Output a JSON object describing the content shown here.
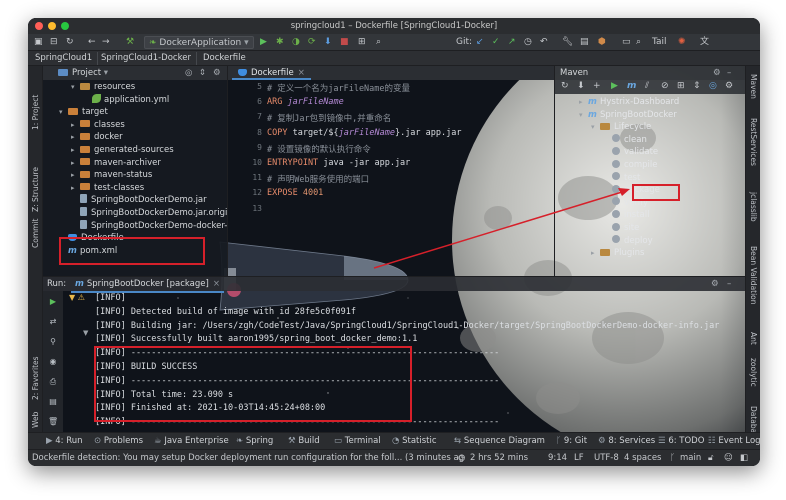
{
  "window": {
    "title": "springcloud1 – Dockerfile [SpringCloud1-Docker]"
  },
  "toolbar": {
    "run_config": "DockerApplication",
    "git_label": "Git:",
    "tail_label": "Tail"
  },
  "breadcrumbs": [
    "SpringCloud1",
    "SpringCloud1-Docker",
    "Dockerfile"
  ],
  "left_stripe": [
    "1: Project",
    "Z: Structure",
    "Commit",
    "2: Favorites",
    "Web"
  ],
  "right_stripe": [
    "Maven",
    "RestServices",
    "jclasslib",
    "Bean Validation",
    "Ant",
    "zoolytic",
    "Database"
  ],
  "project": {
    "header": "Project",
    "tree": [
      {
        "label": "resources",
        "depth": 2,
        "icon": "folder",
        "arrow": "▾"
      },
      {
        "label": "application.yml",
        "depth": 3,
        "icon": "leaf",
        "arrow": ""
      },
      {
        "label": "target",
        "depth": 1,
        "icon": "folder-orange",
        "arrow": "▾"
      },
      {
        "label": "classes",
        "depth": 2,
        "icon": "folder-orange",
        "arrow": "▸"
      },
      {
        "label": "docker",
        "depth": 2,
        "icon": "folder-orange",
        "arrow": "▸"
      },
      {
        "label": "generated-sources",
        "depth": 2,
        "icon": "folder-orange",
        "arrow": "▸"
      },
      {
        "label": "maven-archiver",
        "depth": 2,
        "icon": "folder-orange",
        "arrow": "▸"
      },
      {
        "label": "maven-status",
        "depth": 2,
        "icon": "folder-orange",
        "arrow": "▸"
      },
      {
        "label": "test-classes",
        "depth": 2,
        "icon": "folder-orange",
        "arrow": "▸"
      },
      {
        "label": "SpringBootDockerDemo.jar",
        "depth": 2,
        "icon": "file",
        "arrow": ""
      },
      {
        "label": "SpringBootDockerDemo.jar.original",
        "depth": 2,
        "icon": "file",
        "arrow": ""
      },
      {
        "label": "SpringBootDockerDemo-docker-info.jar",
        "depth": 2,
        "icon": "file",
        "arrow": ""
      },
      {
        "label": "Dockerfile",
        "depth": 1,
        "icon": "whale",
        "arrow": ""
      },
      {
        "label": "pom.xml",
        "depth": 1,
        "icon": "maven",
        "arrow": ""
      }
    ]
  },
  "editor": {
    "tab": "Dockerfile",
    "lines": [
      {
        "n": "5",
        "parts": [
          {
            "c": "cmt",
            "t": "# 定义一个名为jarFileName的变量"
          }
        ]
      },
      {
        "n": "6",
        "parts": [
          {
            "c": "kw",
            "t": "ARG "
          },
          {
            "c": "var",
            "t": "jarFileName"
          }
        ]
      },
      {
        "n": "7",
        "parts": [
          {
            "c": "cmt",
            "t": "# 复制Jar包到镜像中,并重命名"
          }
        ]
      },
      {
        "n": "8",
        "parts": [
          {
            "c": "kw",
            "t": "COPY "
          },
          {
            "c": "plain",
            "t": "target/${"
          },
          {
            "c": "var",
            "t": "jarFileName"
          },
          {
            "c": "plain",
            "t": "}.jar app.jar"
          }
        ]
      },
      {
        "n": "9",
        "parts": [
          {
            "c": "cmt",
            "t": "# 设置镜像的默认执行命令"
          }
        ]
      },
      {
        "n": "10",
        "parts": [
          {
            "c": "kw",
            "t": "ENTRYPOINT "
          },
          {
            "c": "plain",
            "t": "java -jar app.jar"
          }
        ]
      },
      {
        "n": "11",
        "parts": [
          {
            "c": "cmt",
            "t": "# 声明Web服务使用的端口"
          }
        ]
      },
      {
        "n": "12",
        "parts": [
          {
            "c": "kw",
            "t": "EXPOSE "
          },
          {
            "c": "num",
            "t": "4001"
          }
        ]
      },
      {
        "n": "13",
        "parts": []
      }
    ]
  },
  "maven": {
    "header": "Maven",
    "tree": [
      {
        "label": "Hystrix-Dashboard",
        "depth": 0,
        "icon": "maven",
        "arrow": "▸"
      },
      {
        "label": "SpringBootDocker",
        "depth": 0,
        "icon": "maven",
        "arrow": "▾"
      },
      {
        "label": "Lifecycle",
        "depth": 1,
        "icon": "folder",
        "arrow": "▾"
      },
      {
        "label": "clean",
        "depth": 2,
        "icon": "gear",
        "arrow": ""
      },
      {
        "label": "validate",
        "depth": 2,
        "icon": "gear",
        "arrow": ""
      },
      {
        "label": "compile",
        "depth": 2,
        "icon": "gear",
        "arrow": ""
      },
      {
        "label": "test",
        "depth": 2,
        "icon": "gear",
        "arrow": ""
      },
      {
        "label": "package",
        "depth": 2,
        "icon": "gear",
        "arrow": ""
      },
      {
        "label": "verify",
        "depth": 2,
        "icon": "gear",
        "arrow": ""
      },
      {
        "label": "install",
        "depth": 2,
        "icon": "gear",
        "arrow": ""
      },
      {
        "label": "site",
        "depth": 2,
        "icon": "gear",
        "arrow": ""
      },
      {
        "label": "deploy",
        "depth": 2,
        "icon": "gear",
        "arrow": ""
      },
      {
        "label": "Plugins",
        "depth": 1,
        "icon": "folder",
        "arrow": "▸"
      }
    ]
  },
  "run": {
    "label": "Run:",
    "tab": "SpringBootDocker [package]",
    "lines": [
      "[INFO]",
      "[INFO] Detected build of image with id 28fe5c0f091f",
      "[INFO] Building jar: /Users/zgh/CodeTest/Java/SpringCloud1/SpringCloud1-Docker/target/SpringBootDockerDemo-docker-info.jar",
      "[INFO] Successfully built aaron1995/spring_boot_docker_demo:1.1",
      "[INFO] ------------------------------------------------------------------------",
      "[INFO] BUILD SUCCESS",
      "[INFO] ------------------------------------------------------------------------",
      "[INFO] Total time:  23.090 s",
      "[INFO] Finished at: 2021-10-03T14:45:24+08:00",
      "[INFO] ------------------------------------------------------------------------"
    ]
  },
  "bottom_tools": [
    "4: Run",
    "Problems",
    "Java Enterprise",
    "Spring",
    "Build",
    "Terminal",
    "Statistic",
    "Sequence Diagram",
    "9: Git",
    "8: Services",
    "6: TODO",
    "Event Log"
  ],
  "status": {
    "message": "Dockerfile detection: You may setup Docker deployment run configuration for the foll... (3 minutes ag",
    "time": "2 hrs 52 mins",
    "position": "9:14",
    "line_sep": "LF",
    "encoding": "UTF-8",
    "indent": "4 spaces",
    "branch": "main"
  },
  "colors": {
    "accent": "#4a88c7",
    "highlight": "#d6202a",
    "background": "#10141a"
  }
}
